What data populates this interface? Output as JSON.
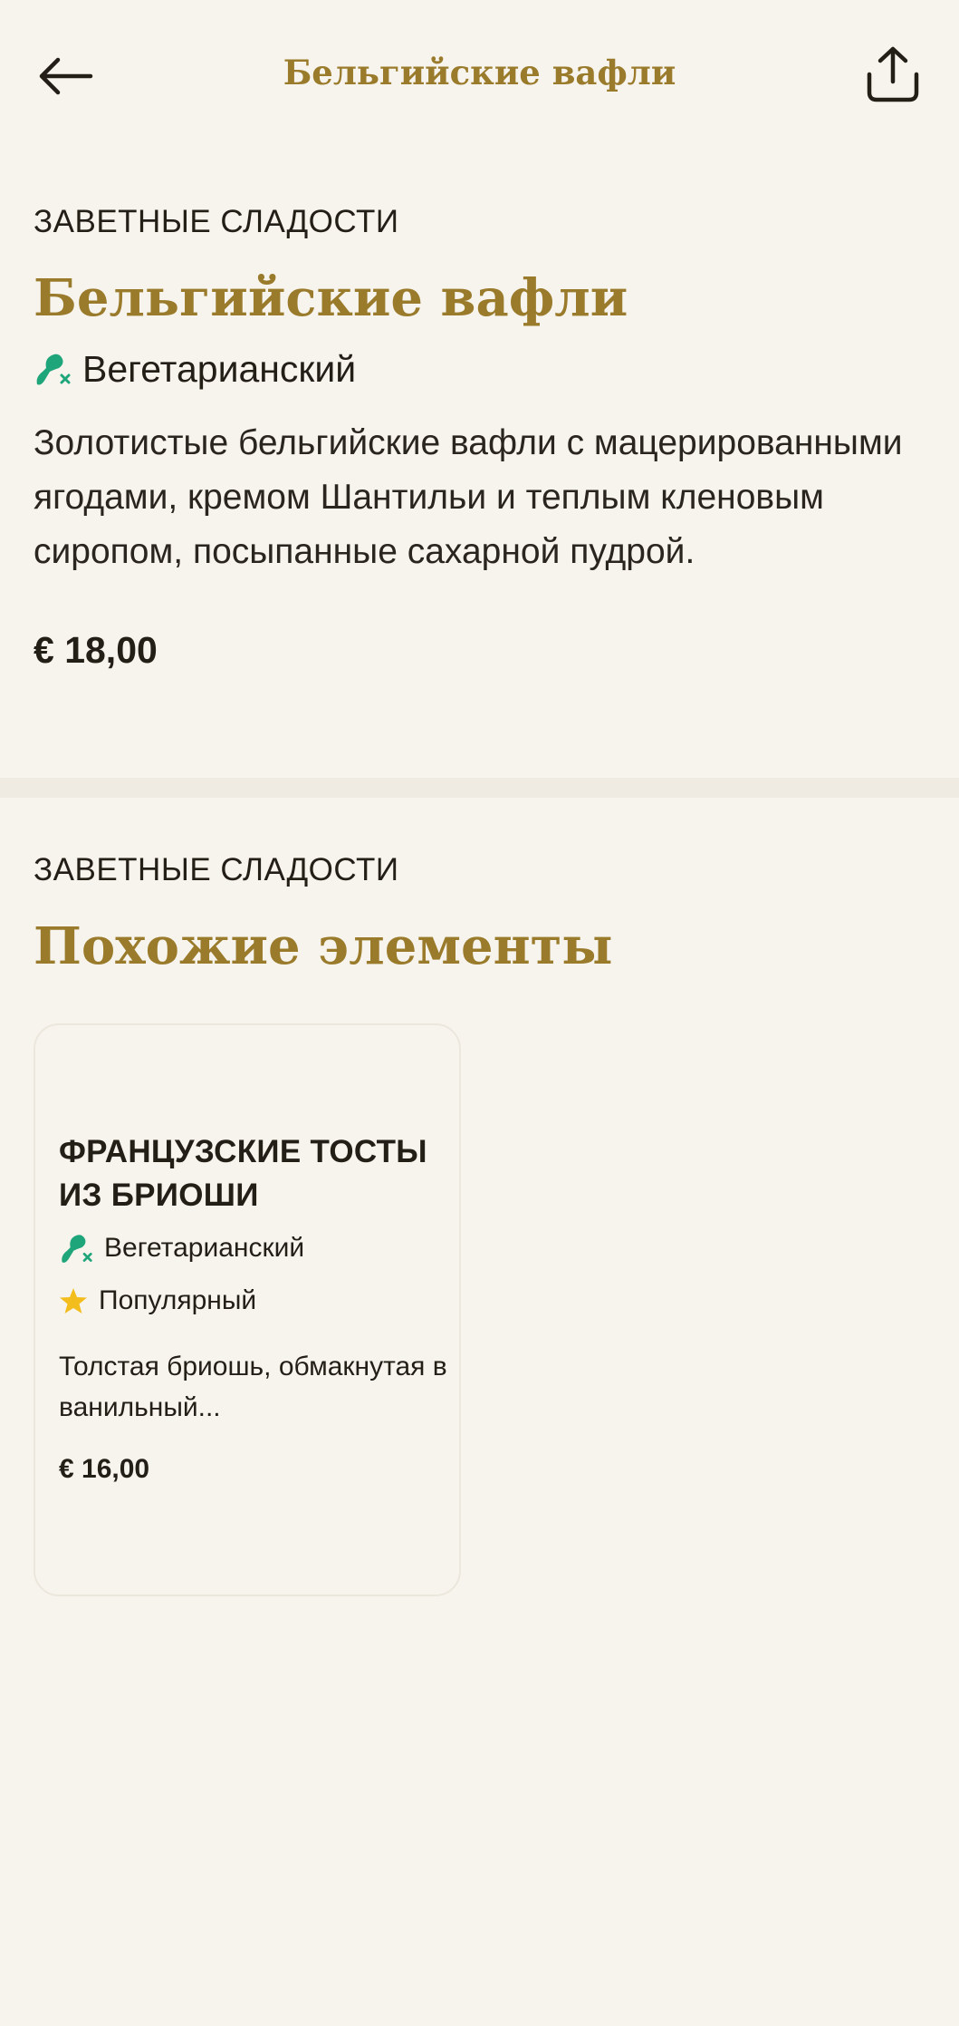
{
  "header": {
    "title": "Бельгийские вафли",
    "back_icon": "arrow-left-icon",
    "share_icon": "share-icon"
  },
  "item": {
    "category": "ЗАВЕТНЫЕ СЛАДОСТИ",
    "title": "Бельгийские вафли",
    "tag": {
      "label": "Вегетарианский",
      "icon": "vegetarian-icon"
    },
    "description": "Золотистые бельгийские вафли с мацерированными ягодами, кремом Шантильи и теплым кленовым сиропом, посыпанные сахарной пудрой.",
    "price": "€ 18,00"
  },
  "similar": {
    "category": "ЗАВЕТНЫЕ СЛАДОСТИ",
    "title": "Похожие элементы",
    "items": [
      {
        "name": "ФРАНЦУЗСКИЕ ТОСТЫ ИЗ БРИОШИ",
        "tags": [
          {
            "label": "Вегетарианский",
            "icon": "vegetarian-icon"
          },
          {
            "label": "Популярный",
            "icon": "star-icon"
          }
        ],
        "description": "Толстая бриошь, обмакнутая в ванильный...",
        "price": "€ 16,00"
      }
    ]
  },
  "colors": {
    "background": "#f7f4ee",
    "accent_gold": "#9a7b2b",
    "text": "#231f17",
    "vegetarian_green": "#1fa57a",
    "star_yellow": "#f2bd1d"
  }
}
